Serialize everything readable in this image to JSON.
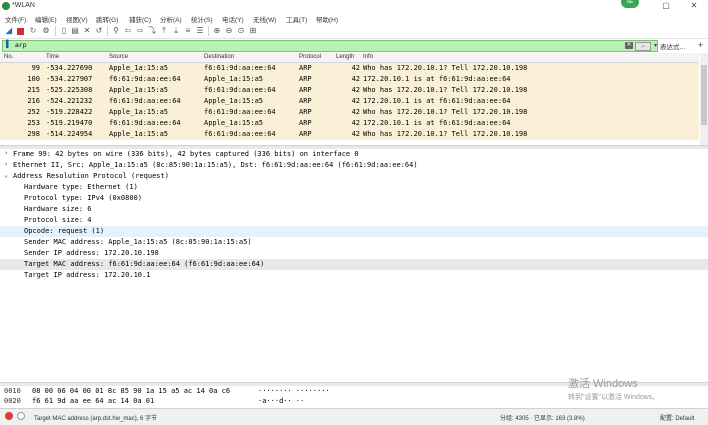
{
  "window": {
    "title": "*WLAN",
    "badge": "SE"
  },
  "menu": [
    "文件(F)",
    "编辑(E)",
    "视图(V)",
    "跳转(G)",
    "捕获(C)",
    "分析(A)",
    "统计(S)",
    "电话(Y)",
    "无线(W)",
    "工具(T)",
    "帮助(H)"
  ],
  "filter": {
    "value": "arp",
    "expression_label": "表达式…",
    "plus": "+"
  },
  "columns": [
    "No.",
    "Time",
    "Source",
    "Destination",
    "Protocol",
    "Length",
    "Info"
  ],
  "packets": [
    {
      "no": "99",
      "time": "-534.227690",
      "src": "Apple_1a:15:a5",
      "dst": "f6:61:9d:aa:ee:64",
      "proto": "ARP",
      "len": "42",
      "info": "Who has 172.20.10.1? Tell 172.20.10.198"
    },
    {
      "no": "100",
      "time": "-534.227907",
      "src": "f6:61:9d:aa:ee:64",
      "dst": "Apple_1a:15:a5",
      "proto": "ARP",
      "len": "42",
      "info": "172.20.10.1 is at f6:61:9d:aa:ee:64"
    },
    {
      "no": "215",
      "time": "-525.225308",
      "src": "Apple_1a:15:a5",
      "dst": "f6:61:9d:aa:ee:64",
      "proto": "ARP",
      "len": "42",
      "info": "Who has 172.20.10.1? Tell 172.20.10.198"
    },
    {
      "no": "216",
      "time": "-524.221232",
      "src": "f6:61:9d:aa:ee:64",
      "dst": "Apple_1a:15:a5",
      "proto": "ARP",
      "len": "42",
      "info": "172.20.10.1 is at f6:61:9d:aa:ee:64"
    },
    {
      "no": "252",
      "time": "-519.228422",
      "src": "Apple_1a:15:a5",
      "dst": "f6:61:9d:aa:ee:64",
      "proto": "ARP",
      "len": "42",
      "info": "Who has 172.20.10.1? Tell 172.20.10.198"
    },
    {
      "no": "253",
      "time": "-519.219470",
      "src": "f6:61:9d:aa:ee:64",
      "dst": "Apple_1a:15:a5",
      "proto": "ARP",
      "len": "42",
      "info": "172.20.10.1 is at f6:61:9d:aa:ee:64"
    },
    {
      "no": "298",
      "time": "-514.224954",
      "src": "Apple_1a:15:a5",
      "dst": "f6:61:9d:aa:ee:64",
      "proto": "ARP",
      "len": "42",
      "info": "Who has 172.20.10.1? Tell 172.20.10.198"
    }
  ],
  "details": [
    {
      "tw": ">",
      "text": "Frame 99: 42 bytes on wire (336 bits), 42 bytes captured (336 bits) on interface 0"
    },
    {
      "tw": ">",
      "text": "Ethernet II, Src: Apple_1a:15:a5 (8c:85:90:1a:15:a5), Dst: f6:61:9d:aa:ee:64 (f6:61:9d:aa:ee:64)"
    },
    {
      "tw": "v",
      "text": "Address Resolution Protocol (request)"
    },
    {
      "text": "Hardware type: Ethernet (1)"
    },
    {
      "text": "Protocol type: IPv4 (0x0800)"
    },
    {
      "text": "Hardware size: 6"
    },
    {
      "text": "Protocol size: 4"
    },
    {
      "text": "Opcode: request (1)"
    },
    {
      "text": "Sender MAC address: Apple_1a:15:a5 (8c:85:90:1a:15:a5)"
    },
    {
      "text": "Sender IP address: 172.20.10.198"
    },
    {
      "text": "Target MAC address: f6:61:9d:aa:ee:64 (f6:61:9d:aa:ee:64)"
    },
    {
      "text": "Target IP address: 172.20.10.1"
    }
  ],
  "bytes": [
    {
      "offset": "0010",
      "hex": "08 00 06 04 00 01 8c 85  90 1a 15 a5 ac 14 0a c6",
      "ascii": "········ ········"
    },
    {
      "offset": "0020",
      "hex": "f6 61 9d aa ee 64 ac 14  0a 01",
      "ascii": "·a···d·· ··"
    }
  ],
  "watermark": {
    "line1": "激活 Windows",
    "line2": "转到\"设置\"以激活 Windows。"
  },
  "status": {
    "field": "Target MAC address (arp.dst.hw_mac), 6 字节",
    "stats": "分组: 4305 · 已显示: 163 (3.8%)",
    "profile": "配置: Default"
  }
}
